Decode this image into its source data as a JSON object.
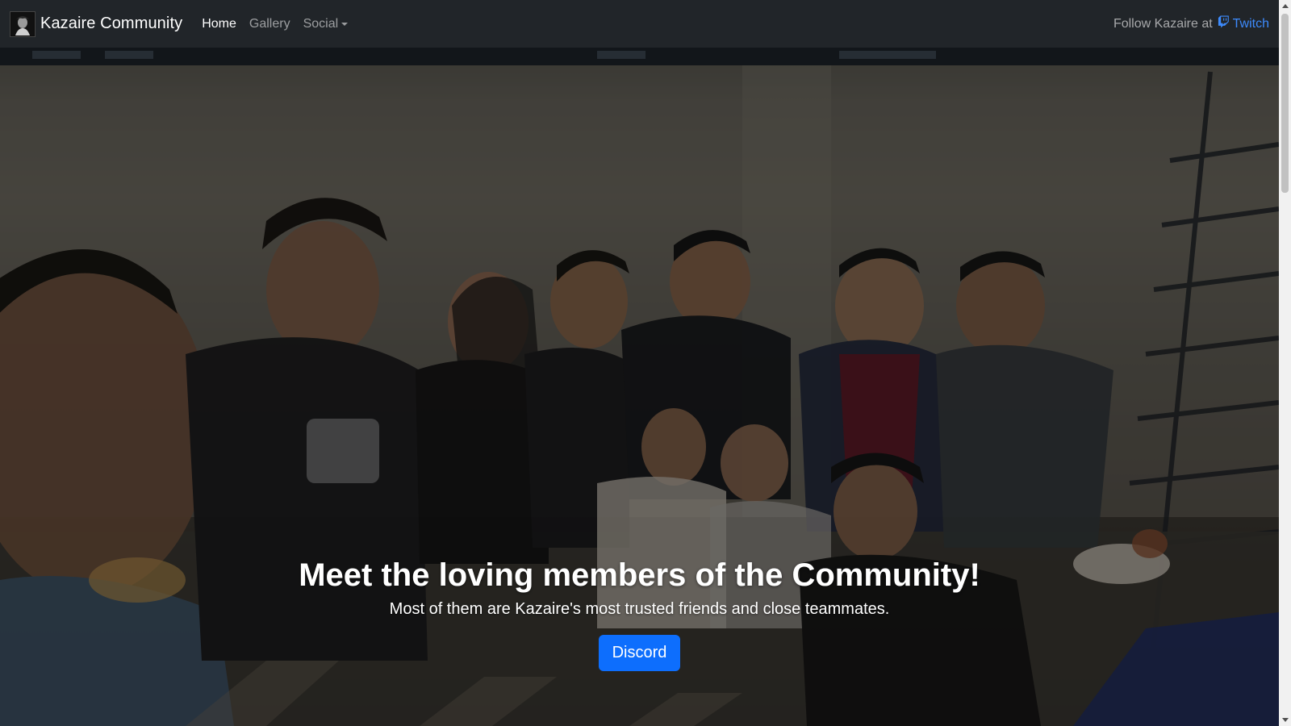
{
  "navbar": {
    "brand": "Kazaire Community",
    "links": [
      {
        "label": "Home",
        "active": true
      },
      {
        "label": "Gallery",
        "active": false
      },
      {
        "label": "Social",
        "active": false,
        "dropdown": true
      }
    ],
    "follow_text": "Follow Kazaire at",
    "twitch_label": "Twitch",
    "twitch_icon": "twitch-icon"
  },
  "hero": {
    "image": "community-group-photo",
    "title": "Meet the loving members of the Community!",
    "subtitle": "Most of them are Kazaire's most trusted friends and close teammates.",
    "button_label": "Discord"
  },
  "colors": {
    "navbar_bg": "#212529",
    "link_blue": "#3d8bfd",
    "button_blue": "#0d6efd"
  }
}
